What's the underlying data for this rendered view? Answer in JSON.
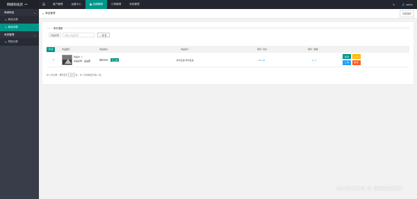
{
  "app": {
    "title": "网络科技店",
    "title_suffix": "***"
  },
  "topnav": {
    "hamburger": "☰",
    "items": [
      "客户管理",
      "运营中心",
      "店铺管理",
      "订单管理",
      "系统管理"
    ],
    "active_index": 2,
    "refresh": "↻",
    "user": "admin"
  },
  "sidebar": {
    "groups": [
      {
        "label": "商城商品",
        "items": [
          {
            "label": "商品分类"
          },
          {
            "label": "商品列表",
            "active": true
          }
        ]
      },
      {
        "label": "系统管理",
        "items": [
          {
            "label": "导航分类"
          }
        ]
      }
    ]
  },
  "tabbar": {
    "tab_label": "商品管理",
    "close": "×",
    "ops": "标签操作"
  },
  "filter": {
    "legend": "条件搜索",
    "label": "商品名称",
    "placeholder": "请输入商品名称",
    "search_button": "搜 索"
  },
  "table": {
    "add_button": "添 加",
    "headers": [
      "商品图片",
      "商品信息",
      "商品简介",
      "库存 / 售价",
      "排序 / 销量"
    ],
    "rows": [
      {
        "index": "1",
        "name": "商品01 ☆",
        "sub": "商品名称：品品图",
        "info_label": "销售状态：",
        "badge": "已上架",
        "desc": "萨尔瓦多 萨尔瓦多",
        "stock_price": "99 / 99",
        "sort_sales": "0 / 0",
        "actions": [
          {
            "label": "编 辑",
            "color": "#009688"
          },
          {
            "label": "上 架",
            "color": "#ffb800"
          },
          {
            "label": "入 库",
            "color": "#1e9fff"
          },
          {
            "label": "删 除",
            "color": "#ff5722"
          }
        ]
      }
    ]
  },
  "pager": {
    "prefix": "共 1 条记录，每页显示",
    "page_size": "10 ▾",
    "suffix": "条，共 1 页当前显示第 1 页。"
  },
  "watermark": "稀金技术社区 @ 源源麦财科技",
  "colors": {
    "accent": "#009688",
    "topbar": "#23262e",
    "sidebar": "#393d49"
  }
}
